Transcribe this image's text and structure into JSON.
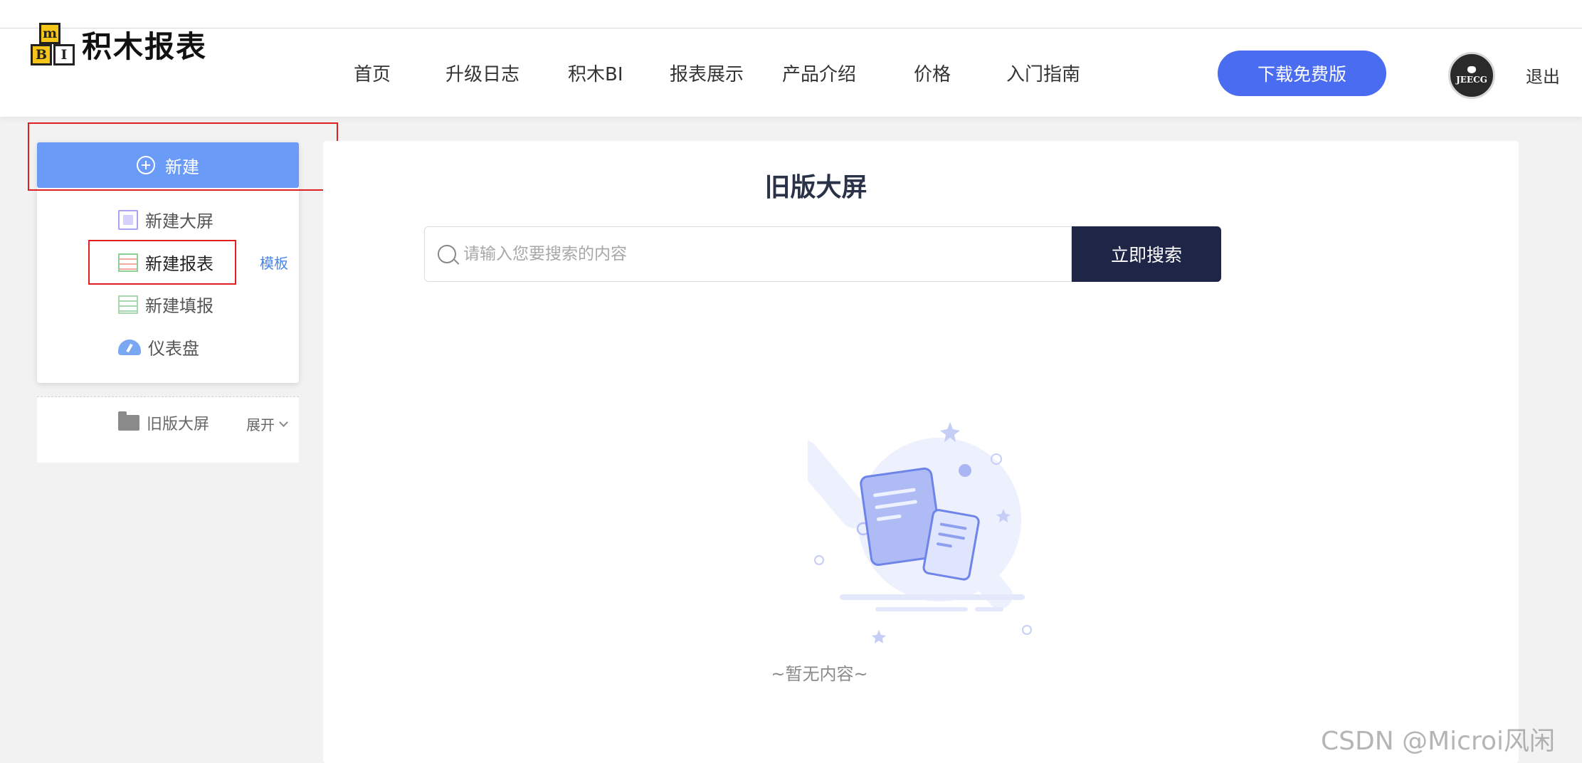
{
  "header": {
    "logo_blocks": [
      "m",
      "B",
      "I"
    ],
    "logo_text": "积木报表",
    "nav": [
      {
        "label": "首页"
      },
      {
        "label": "升级日志"
      },
      {
        "label": "积木BI"
      },
      {
        "label": "报表展示"
      },
      {
        "label": "产品介绍"
      },
      {
        "label": "价格"
      },
      {
        "label": "入门指南"
      }
    ],
    "download_label": "下载免费版",
    "avatar_text": "JEECG",
    "logout_label": "退出"
  },
  "sidebar": {
    "new_label": "新建",
    "menu": [
      {
        "label": "新建大屏",
        "icon": "screen-icon"
      },
      {
        "label": "新建报表",
        "icon": "table-icon"
      },
      {
        "label": "新建填报",
        "icon": "fill-table-icon"
      },
      {
        "label": "仪表盘",
        "icon": "gauge-icon"
      }
    ],
    "template_label": "模板",
    "folder_label": "旧版大屏",
    "expand_label": "展开"
  },
  "main": {
    "title": "旧版大屏",
    "search_placeholder": "请输入您要搜索的内容",
    "search_button": "立即搜索",
    "empty_text": "~暂无内容~"
  },
  "watermark": "CSDN @Microi风闲",
  "colors": {
    "primary": "#4a6cf0",
    "new_button": "#6a9cf7",
    "search_button": "#1f2547",
    "highlight_frame": "#e02020"
  }
}
